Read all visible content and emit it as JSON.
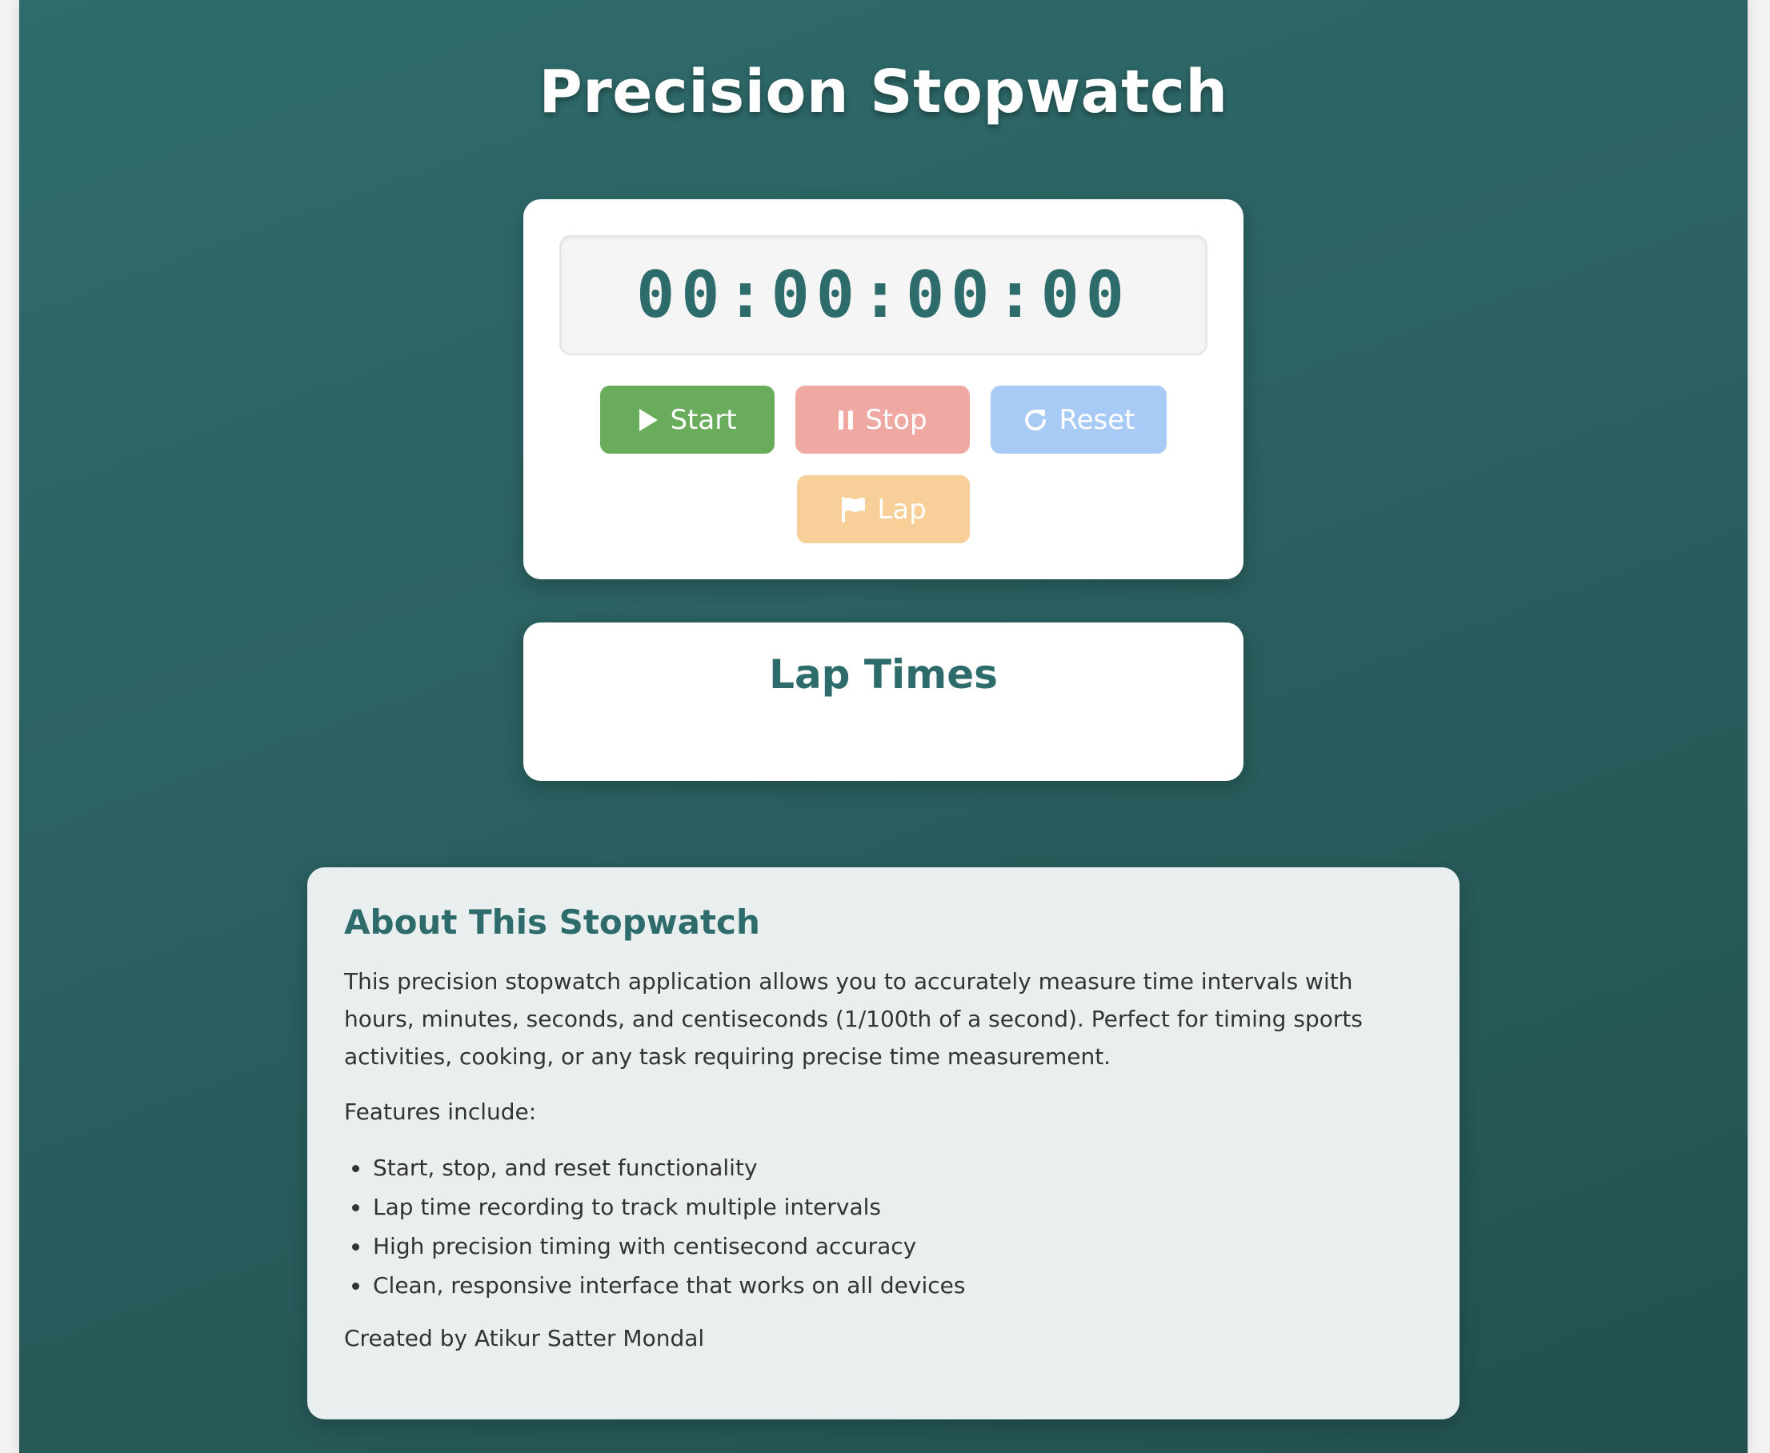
{
  "app": {
    "title": "Precision Stopwatch"
  },
  "timer": {
    "display": "00:00:00:00"
  },
  "controls": {
    "start_label": "Start",
    "stop_label": "Stop",
    "reset_label": "Reset",
    "lap_label": "Lap",
    "start_icon": "play-icon",
    "stop_icon": "pause-icon",
    "reset_icon": "reset-icon",
    "lap_icon": "flag-icon"
  },
  "laps": {
    "title": "Lap Times",
    "items": []
  },
  "about": {
    "heading": "About This Stopwatch",
    "description": "This precision stopwatch application allows you to accurately measure time intervals with hours, minutes, seconds, and centiseconds (1/100th of a second). Perfect for timing sports activities, cooking, or any task requiring precise time measurement.",
    "features_intro": "Features include:",
    "features": [
      "Start, stop, and reset functionality",
      "Lap time recording to track multiple intervals",
      "High precision timing with centisecond accuracy",
      "Clean, responsive interface that works on all devices"
    ],
    "credit": "Created by Atikur Satter Mondal"
  },
  "colors": {
    "background": "#2a5f5f",
    "accent": "#2e6b6b",
    "start": "#68ac5c",
    "stop": "#f0a9a2",
    "reset": "#a8cbf5",
    "lap": "#f8cf98"
  }
}
